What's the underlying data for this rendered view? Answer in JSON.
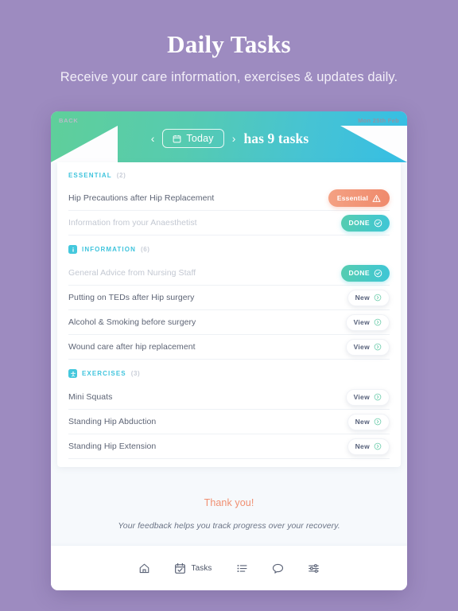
{
  "page": {
    "title": "Daily Tasks",
    "subtitle": "Receive your care information, exercises & updates daily."
  },
  "app_header": {
    "back_label": "BACK",
    "date_label": "Mon 25th Feb",
    "prev_arrow": "‹",
    "next_arrow": "›",
    "today_label": "Today",
    "task_count_label": "has 9 tasks",
    "calendar_icon": "calendar-icon"
  },
  "sections": [
    {
      "id": "essential",
      "label": "ESSENTIAL",
      "count": "(2)",
      "icon": null,
      "rows": [
        {
          "title": "Hip Precautions after Hip Replacement",
          "muted": false,
          "badge": {
            "style": "essential",
            "label": "Essential",
            "icon": "warning-triangle-icon"
          }
        },
        {
          "title": "Information from your Anaesthetist",
          "muted": true,
          "badge": {
            "style": "done",
            "label": "DONE",
            "icon": "check-circle-icon"
          }
        }
      ]
    },
    {
      "id": "information",
      "label": "INFORMATION",
      "count": "(6)",
      "icon": "info-icon",
      "icon_glyph": "i",
      "rows": [
        {
          "title": "General Advice from Nursing Staff",
          "muted": true,
          "badge": {
            "style": "done",
            "label": "DONE",
            "icon": "check-circle-icon"
          }
        },
        {
          "title": "Putting on TEDs after Hip surgery",
          "muted": false,
          "badge": {
            "style": "plain",
            "label": "New",
            "icon": "chevron-right-circle-icon"
          }
        },
        {
          "title": "Alcohol & Smoking before surgery",
          "muted": false,
          "badge": {
            "style": "plain",
            "label": "View",
            "icon": "chevron-right-circle-icon"
          }
        },
        {
          "title": "Wound care after hip replacement",
          "muted": false,
          "badge": {
            "style": "plain",
            "label": "View",
            "icon": "chevron-right-circle-icon"
          }
        }
      ]
    },
    {
      "id": "exercises",
      "label": "EXERCISES",
      "count": "(3)",
      "icon": "exercise-person-icon",
      "icon_glyph": "☩",
      "rows": [
        {
          "title": "Mini Squats",
          "muted": false,
          "badge": {
            "style": "plain",
            "label": "View",
            "icon": "chevron-right-circle-icon"
          }
        },
        {
          "title": "Standing Hip Abduction",
          "muted": false,
          "badge": {
            "style": "plain",
            "label": "New",
            "icon": "chevron-right-circle-icon"
          }
        },
        {
          "title": "Standing Hip Extension",
          "muted": false,
          "badge": {
            "style": "plain",
            "label": "New",
            "icon": "chevron-right-circle-icon"
          }
        }
      ]
    }
  ],
  "footer": {
    "thanks_title": "Thank you!",
    "thanks_subtitle": "Your feedback helps you track progress over your recovery."
  },
  "tabbar": {
    "items": [
      {
        "icon": "home-icon",
        "label": ""
      },
      {
        "icon": "calendar-check-icon",
        "label": "Tasks"
      },
      {
        "icon": "list-icon",
        "label": ""
      },
      {
        "icon": "chat-bubble-icon",
        "label": ""
      },
      {
        "icon": "sliders-icon",
        "label": ""
      }
    ]
  },
  "colors": {
    "page_background": "#9d8bc0",
    "accent_teal": "#3fc4dd",
    "accent_green": "#5fcf9a",
    "accent_orange": "#ef8a6c",
    "panel": "#ffffff"
  }
}
